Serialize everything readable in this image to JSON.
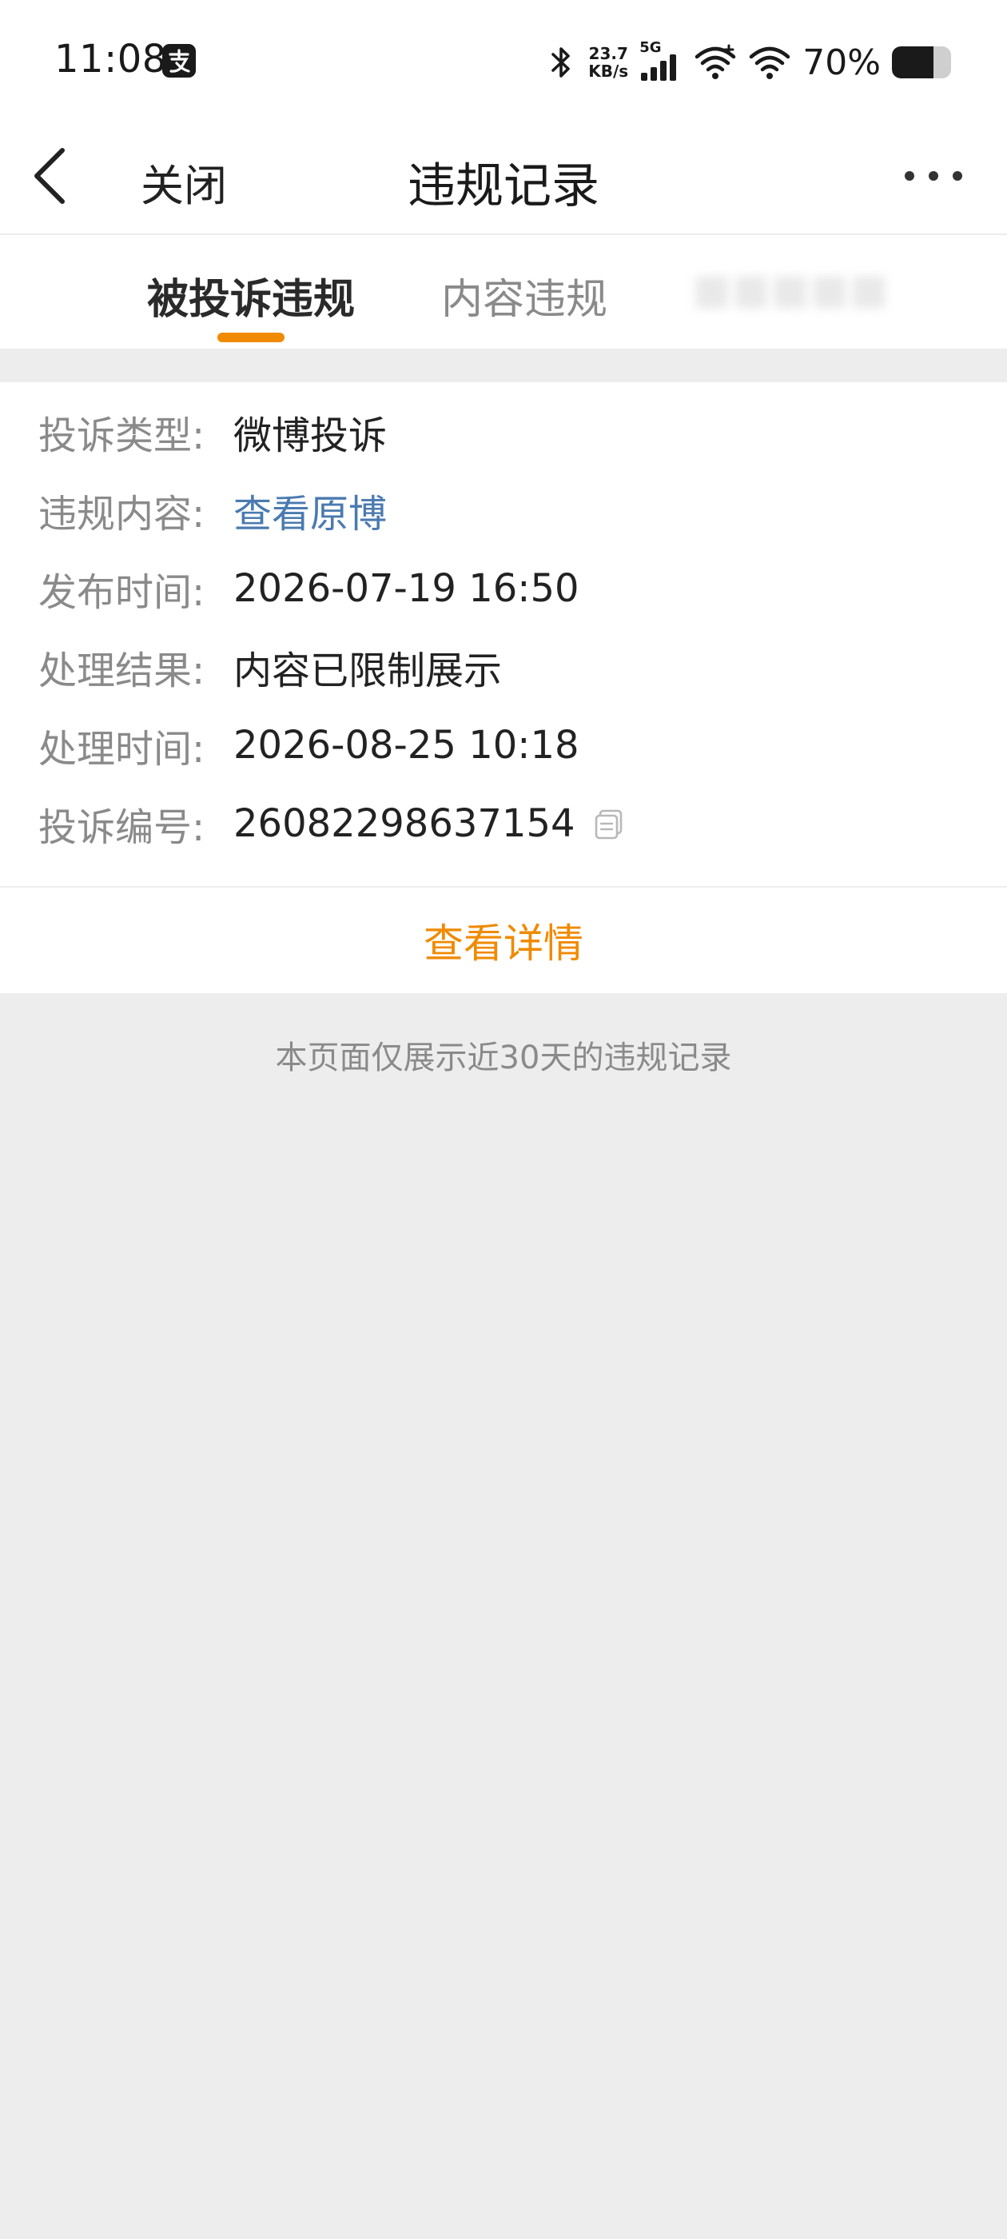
{
  "status_bar": {
    "time": "11:08",
    "network_speed_value": "23.7",
    "network_speed_unit": "KB/s",
    "network_type": "5G",
    "battery_percent": "70%",
    "battery_level": 0.7
  },
  "nav": {
    "close_label": "关闭",
    "title": "违规记录"
  },
  "tabs": [
    {
      "label": "被投诉违规",
      "active": true
    },
    {
      "label": "内容违规",
      "active": false
    },
    {
      "label": "",
      "active": false
    }
  ],
  "record": {
    "complaint_type_label": "投诉类型:",
    "complaint_type_value": "微博投诉",
    "content_label": "违规内容:",
    "content_value": "查看原博",
    "publish_time_label": "发布时间:",
    "publish_time_value": "2026-07-19 16:50",
    "result_label": "处理结果:",
    "result_value": "内容已限制展示",
    "process_time_label": "处理时间:",
    "process_time_value": "2026-08-25 10:18",
    "complaint_id_label": "投诉编号:",
    "complaint_id_value": "26082298637154"
  },
  "detail_button_label": "查看详情",
  "footer_note": "本页面仅展示近30天的违规记录",
  "colors": {
    "accent": "#f08a00",
    "link": "#4a7ab0",
    "background": "#ededed"
  }
}
